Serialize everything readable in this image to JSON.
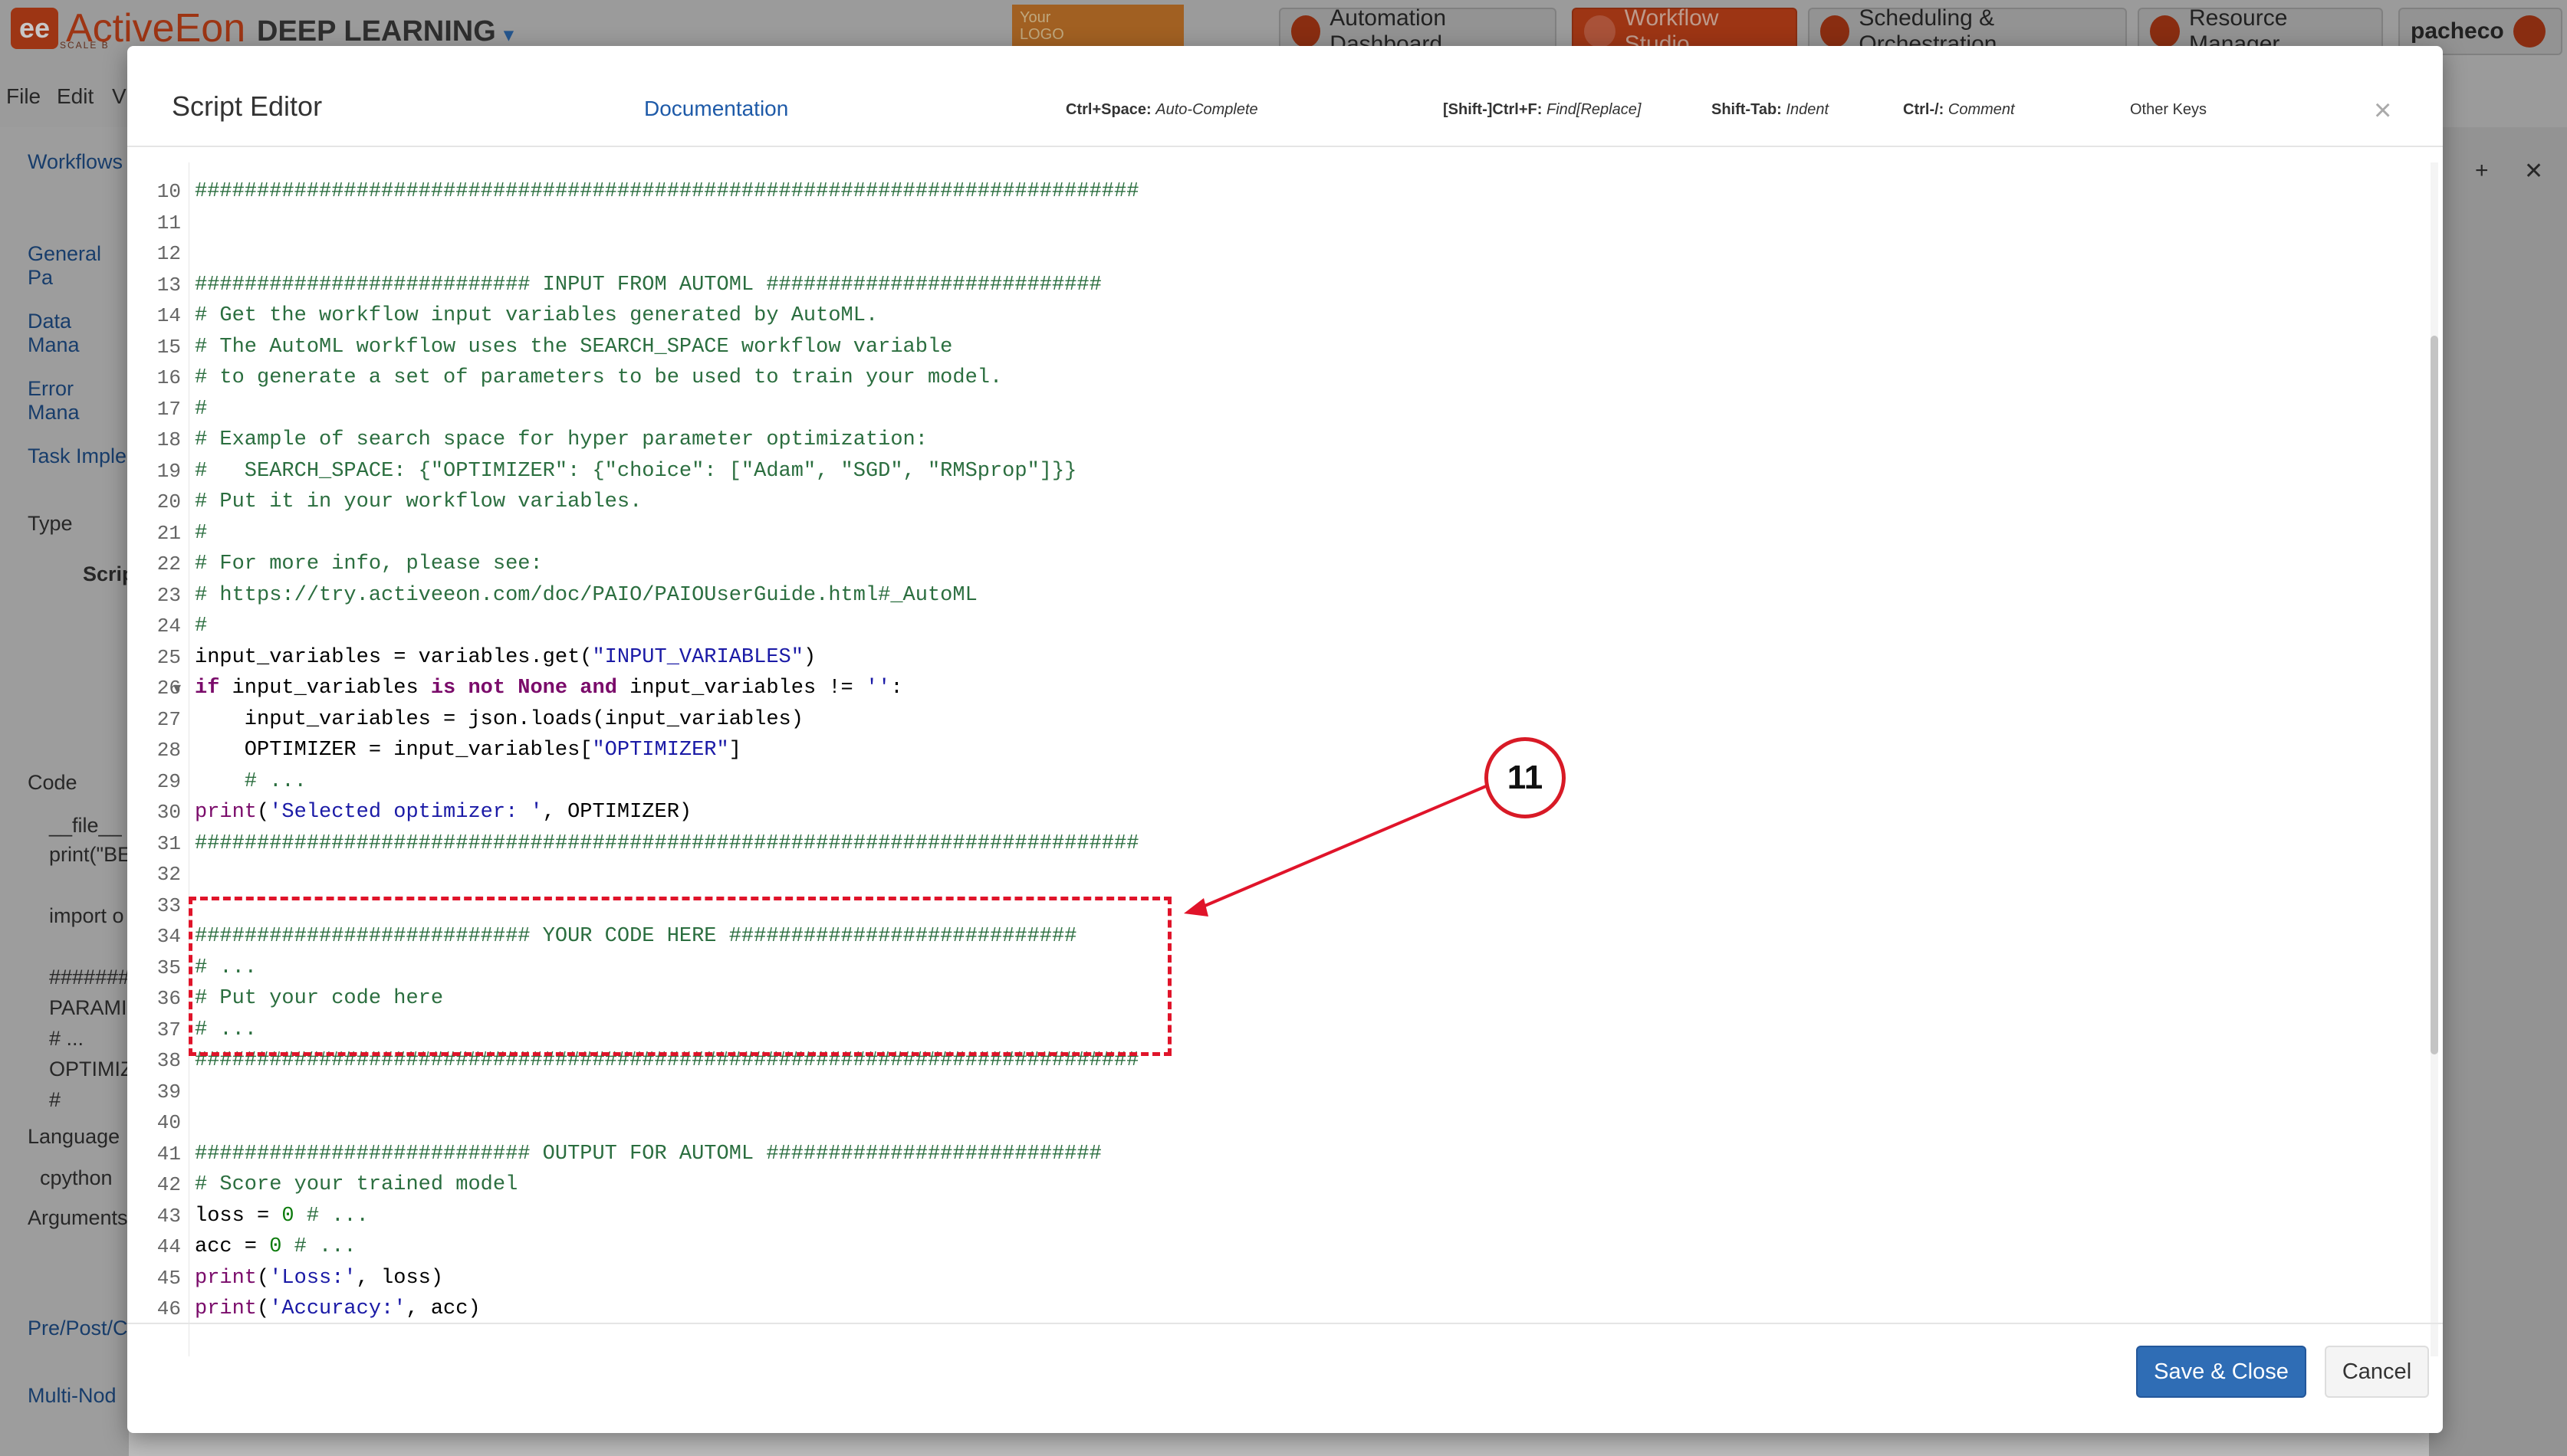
{
  "app": {
    "logo_text": "ActiveEon",
    "logo_sub": "SCALE B",
    "product": "DEEP LEARNING",
    "your_logo": "Your\nLOGO",
    "top_buttons": [
      "Automation Dashboard",
      "Workflow Studio",
      "Scheduling & Orchestration",
      "Resource Manager",
      "pacheco"
    ],
    "menu": [
      "File",
      "Edit",
      "V"
    ],
    "left_panel": {
      "workflows": "Workflows",
      "sections": [
        "General Pa",
        "Data Mana",
        "Error Mana",
        "Task Imple"
      ],
      "type_label": "Type",
      "script_label": "Scrip",
      "code_label": "Code",
      "code_preview": [
        "__file__",
        "print(\"BE",
        "import o",
        "#######",
        "PARAMI",
        "# ...",
        "OPTIMIZ",
        "#"
      ],
      "language_label": "Language",
      "language_value": "cpython",
      "arguments_label": "Arguments",
      "bottom_sections": [
        "Pre/Post/C",
        "Multi-Nod"
      ]
    },
    "canvas_tools": [
      "+",
      "✕"
    ]
  },
  "modal": {
    "title": "Script Editor",
    "documentation": "Documentation",
    "hints": [
      {
        "key": "Ctrl+Space:",
        "action": "Auto-Complete"
      },
      {
        "key": "[Shift-]Ctrl+F:",
        "action": "Find[Replace]"
      },
      {
        "key": "Shift-Tab:",
        "action": "Indent"
      },
      {
        "key": "Ctrl-/:",
        "action": "Comment"
      },
      {
        "key": "",
        "action": "Other Keys"
      }
    ],
    "close": "×",
    "save_button": "Save & Close",
    "cancel_button": "Cancel"
  },
  "editor": {
    "lines": [
      {
        "n": "10",
        "code": "############################################################################"
      },
      {
        "n": "11",
        "code": ""
      },
      {
        "n": "12",
        "code": ""
      },
      {
        "n": "13",
        "code": "########################### INPUT FROM AUTOML ###########################"
      },
      {
        "n": "14",
        "code": "# Get the workflow input variables generated by AutoML."
      },
      {
        "n": "15",
        "code": "# The AutoML workflow uses the SEARCH_SPACE workflow variable"
      },
      {
        "n": "16",
        "code": "# to generate a set of parameters to be used to train your model."
      },
      {
        "n": "17",
        "code": "#"
      },
      {
        "n": "18",
        "code": "# Example of search space for hyper parameter optimization:"
      },
      {
        "n": "19",
        "code": "#   SEARCH_SPACE: {\"OPTIMIZER\": {\"choice\": [\"Adam\", \"SGD\", \"RMSprop\"]}}"
      },
      {
        "n": "20",
        "code": "# Put it in your workflow variables."
      },
      {
        "n": "21",
        "code": "#"
      },
      {
        "n": "22",
        "code": "# For more info, please see:"
      },
      {
        "n": "23",
        "code": "# https://try.activeeon.com/doc/PAIO/PAIOUserGuide.html#_AutoML"
      },
      {
        "n": "24",
        "code": "#"
      },
      {
        "n": "25",
        "code": "input_variables = variables.get(\"INPUT_VARIABLES\")"
      },
      {
        "n": "26",
        "code": "if input_variables is not None and input_variables != '':",
        "fold": "▾"
      },
      {
        "n": "27",
        "code": "    input_variables = json.loads(input_variables)"
      },
      {
        "n": "28",
        "code": "    OPTIMIZER = input_variables[\"OPTIMIZER\"]"
      },
      {
        "n": "29",
        "code": "    # ..."
      },
      {
        "n": "30",
        "code": "print('Selected optimizer: ', OPTIMIZER)"
      },
      {
        "n": "31",
        "code": "############################################################################"
      },
      {
        "n": "32",
        "code": ""
      },
      {
        "n": "33",
        "code": ""
      },
      {
        "n": "34",
        "code": "########################### YOUR CODE HERE ############################"
      },
      {
        "n": "35",
        "code": "# ..."
      },
      {
        "n": "36",
        "code": "# Put your code here"
      },
      {
        "n": "37",
        "code": "# ..."
      },
      {
        "n": "38",
        "code": "############################################################################"
      },
      {
        "n": "39",
        "code": ""
      },
      {
        "n": "40",
        "code": ""
      },
      {
        "n": "41",
        "code": "########################### OUTPUT FOR AUTOML ###########################"
      },
      {
        "n": "42",
        "code": "# Score your trained model"
      },
      {
        "n": "43",
        "code": "loss = 0 # ..."
      },
      {
        "n": "44",
        "code": "acc = 0 # ..."
      },
      {
        "n": "45",
        "code": "print('Loss:', loss)"
      },
      {
        "n": "46",
        "code": "print('Accuracy:', acc)"
      }
    ]
  },
  "annotation": {
    "badge": "11",
    "color": "#d81a26"
  }
}
